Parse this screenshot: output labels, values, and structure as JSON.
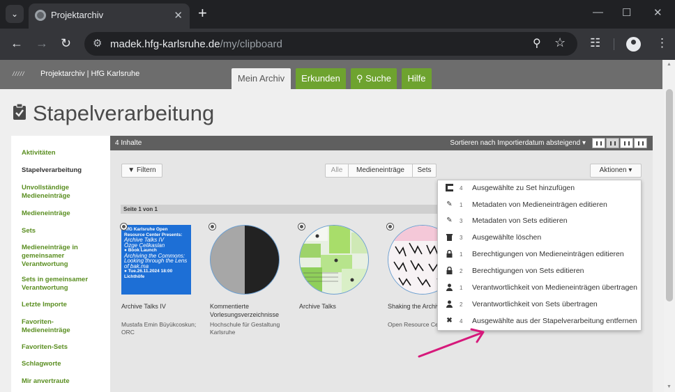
{
  "browser": {
    "tab_title": "Projektarchiv",
    "url_host": "madek.hfg-karlsruhe.de",
    "url_path": "/my/clipboard"
  },
  "site": {
    "logo_text": "/////",
    "title": "Projektarchiv | HfG Karlsruhe",
    "nav": [
      "Mein Archiv",
      "Erkunden",
      "Suche",
      "Hilfe"
    ]
  },
  "page": {
    "heading": "Stapelverarbeitung"
  },
  "sidebar": {
    "items": [
      "Aktivitäten",
      "Stapelverarbeitung",
      "Unvollständige Medieneinträge",
      "Medieneinträge",
      "Sets",
      "Medieneinträge in gemeinsamer Verantwortung",
      "Sets in gemeinsamer Verantwortung",
      "Letzte Importe",
      "Favoriten-Medieneinträge",
      "Favoriten-Sets",
      "Schlagworte",
      "Mir anvertraute"
    ],
    "current_index": 1
  },
  "main": {
    "count": "4 Inhalte",
    "sort": "Sortieren nach Importierdatum absteigend ▾",
    "filter_button": "Filtern",
    "segments": [
      "Alle",
      "Medieneinträge",
      "Sets"
    ],
    "actions_button": "Aktionen ▾",
    "page_label": "Seite 1 von 1",
    "poster_text": {
      "line1": "HfG Karlsruhe Open Resource Center Presents:",
      "line2": "Archive Talks IV",
      "line3": "Özge Çelikaslan",
      "line4": "● Book Launch",
      "line5": "Archiving the Commons: Looking through the Lens of bak.ma",
      "line6": "● Tue.26.11.2024 18:00",
      "line7": "Lichthöfe"
    },
    "cards": [
      {
        "title": "Archive Talks IV",
        "subtitle": "Mustafa Emin Büyükcoskun; ORC"
      },
      {
        "title": "Kommentierte Vorlesungsverzeichnisse",
        "subtitle": "Hochschule für Gestaltung Karlsruhe"
      },
      {
        "title": "Archive Talks",
        "subtitle": ""
      },
      {
        "title": "Shaking the Archive",
        "subtitle": "Open Resource Center"
      }
    ]
  },
  "actions_menu": {
    "items": [
      {
        "icon": "add-to-set-icon",
        "count": "4",
        "label": "Ausgewählte zu Set hinzufügen"
      },
      {
        "icon": "pencil-icon",
        "count": "1",
        "label": "Metadaten von Medieneinträgen editieren"
      },
      {
        "icon": "pencil-icon",
        "count": "3",
        "label": "Metadaten von Sets editieren"
      },
      {
        "icon": "trash-icon",
        "count": "3",
        "label": "Ausgewählte löschen"
      },
      {
        "icon": "lock-icon",
        "count": "1",
        "label": "Berechtigungen von Medieneinträgen editieren"
      },
      {
        "icon": "lock-icon",
        "count": "2",
        "label": "Berechtigungen von Sets editieren"
      },
      {
        "icon": "user-icon",
        "count": "1",
        "label": "Verantwortlichkeit von Medieneinträgen übertragen"
      },
      {
        "icon": "user-icon",
        "count": "2",
        "label": "Verantwortlichkeit von Sets übertragen"
      },
      {
        "icon": "remove-icon",
        "count": "4",
        "label": "Ausgewählte aus der Stapelverarbeitung entfernen"
      }
    ]
  },
  "colors": {
    "accent_green": "#6ea32f",
    "link_green": "#5a8e21",
    "header_gray": "#6d6d6d",
    "annotation_arrow": "#d6197b"
  }
}
